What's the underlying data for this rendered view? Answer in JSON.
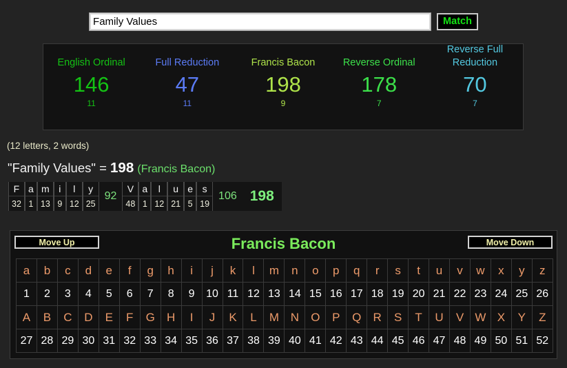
{
  "search": {
    "value": "Family Values",
    "placeholder": "",
    "match_label": "Match"
  },
  "ciphers": [
    {
      "name": "English Ordinal",
      "value": "146",
      "reduced": "11",
      "color": "#14c214"
    },
    {
      "name": "Full Reduction",
      "value": "47",
      "reduced": "11",
      "color": "#5b7bf5"
    },
    {
      "name": "Francis Bacon",
      "value": "198",
      "reduced": "9",
      "color": "#aee34a"
    },
    {
      "name": "Reverse Ordinal",
      "value": "178",
      "reduced": "7",
      "color": "#3ce04a"
    },
    {
      "name": "Reverse Full Reduction",
      "value": "70",
      "reduced": "7",
      "color": "#53c8e0"
    }
  ],
  "meta": {
    "letters_words": "(12 letters, 2 words)"
  },
  "headline": {
    "phrase": "\"Family Values\" =",
    "total": "198",
    "cipher": "(Francis Bacon)"
  },
  "breakdown": {
    "words": [
      {
        "letters": [
          "F",
          "a",
          "m",
          "i",
          "l",
          "y"
        ],
        "values": [
          "32",
          "1",
          "13",
          "9",
          "12",
          "25"
        ],
        "subtotal": "92"
      },
      {
        "letters": [
          "V",
          "a",
          "l",
          "u",
          "e",
          "s"
        ],
        "values": [
          "48",
          "1",
          "12",
          "21",
          "5",
          "19"
        ],
        "subtotal": "106"
      }
    ],
    "total": "198"
  },
  "alphabet_panel": {
    "title": "Francis Bacon",
    "move_up_label": "Move Up",
    "move_down_label": "Move Down",
    "lowercase": [
      "a",
      "b",
      "c",
      "d",
      "e",
      "f",
      "g",
      "h",
      "i",
      "j",
      "k",
      "l",
      "m",
      "n",
      "o",
      "p",
      "q",
      "r",
      "s",
      "t",
      "u",
      "v",
      "w",
      "x",
      "y",
      "z"
    ],
    "lowercase_values": [
      "1",
      "2",
      "3",
      "4",
      "5",
      "6",
      "7",
      "8",
      "9",
      "10",
      "11",
      "12",
      "13",
      "14",
      "15",
      "16",
      "17",
      "18",
      "19",
      "20",
      "21",
      "22",
      "23",
      "24",
      "25",
      "26"
    ],
    "uppercase": [
      "A",
      "B",
      "C",
      "D",
      "E",
      "F",
      "G",
      "H",
      "I",
      "J",
      "K",
      "L",
      "M",
      "N",
      "O",
      "P",
      "Q",
      "R",
      "S",
      "T",
      "U",
      "V",
      "W",
      "X",
      "Y",
      "Z"
    ],
    "uppercase_values": [
      "27",
      "28",
      "29",
      "30",
      "31",
      "32",
      "33",
      "34",
      "35",
      "36",
      "37",
      "38",
      "39",
      "40",
      "41",
      "42",
      "43",
      "44",
      "45",
      "46",
      "47",
      "48",
      "49",
      "50",
      "51",
      "52"
    ]
  },
  "colors": {
    "background": "#232323",
    "panel": "#121212",
    "letter_accent": "#ec9a6a",
    "green_accent": "#7ef07e",
    "button_text": "#f0efa8"
  }
}
